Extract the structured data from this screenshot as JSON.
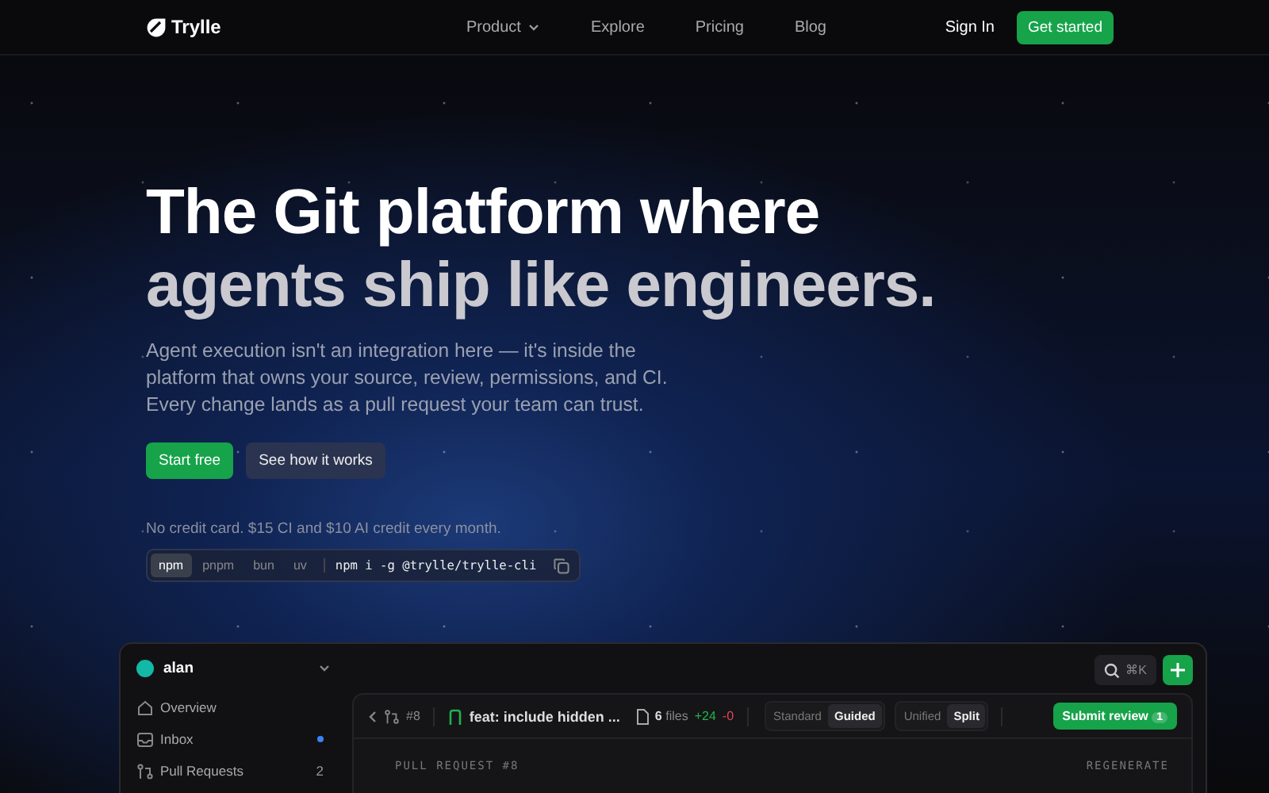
{
  "nav": {
    "brand": "Trylle",
    "links": [
      {
        "label": "Product",
        "dropdown": true
      },
      {
        "label": "Explore",
        "dropdown": false
      },
      {
        "label": "Pricing",
        "dropdown": false
      },
      {
        "label": "Blog",
        "dropdown": false
      }
    ],
    "sign_in": "Sign In",
    "cta": "Get started"
  },
  "hero": {
    "title_line1": "The Git platform where",
    "title_line2": "agents ship like engineers.",
    "subtitle": "Agent execution isn't an integration here — it's inside the platform that owns your source, review, permissions, and CI. Every change lands as a pull request your team can trust.",
    "primary": "Start free",
    "secondary": "See how it works",
    "note": "No credit card. $15 CI and $10 AI credit every month."
  },
  "install": {
    "tabs": [
      {
        "label": "npm",
        "selected": true
      },
      {
        "label": "pnpm",
        "selected": false
      },
      {
        "label": "bun",
        "selected": false
      },
      {
        "label": "uv",
        "selected": false
      }
    ],
    "command": "npm i -g @trylle/trylle-cli"
  },
  "app": {
    "user": "alan",
    "search_shortcut": "⌘K",
    "sidebar": [
      {
        "label": "Overview",
        "kind": "home",
        "dot": false
      },
      {
        "label": "Inbox",
        "kind": "inbox",
        "dot": true
      },
      {
        "label": "Pull Requests",
        "kind": "pr",
        "badge": "2",
        "dot": false
      }
    ],
    "pr": {
      "number": "#8",
      "title": "feat: include hidden ...",
      "files": "6",
      "files_label": "files",
      "additions": "+24",
      "deletions": "-0",
      "mode_toggle": [
        {
          "label": "Standard",
          "selected": false
        },
        {
          "label": "Guided",
          "selected": true
        }
      ],
      "view_toggle": [
        {
          "label": "Unified",
          "selected": false
        },
        {
          "label": "Split",
          "selected": true
        }
      ],
      "submit": "Submit review",
      "submit_count": "1",
      "section_label": "PULL REQUEST #8",
      "regenerate": "REGENERATE"
    }
  }
}
